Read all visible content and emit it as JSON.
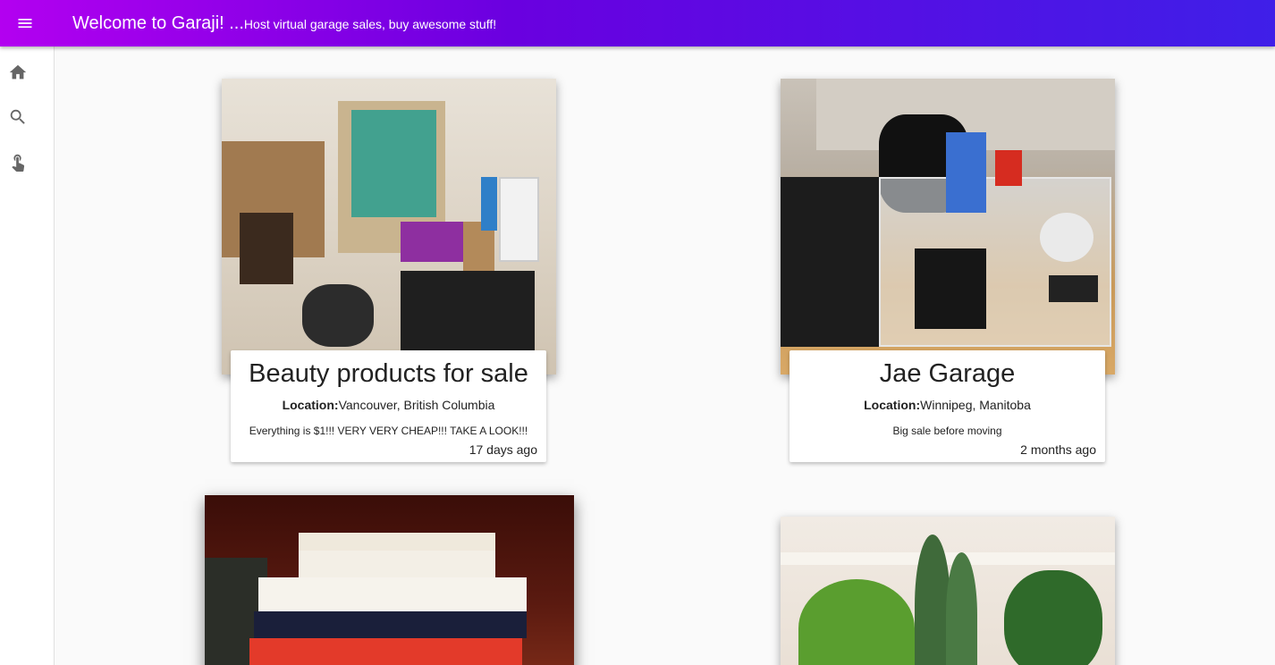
{
  "appbar": {
    "title": "Welcome to Garaji! ...",
    "subtitle": "Host virtual garage sales, buy awesome stuff!",
    "menu_icon": "menu-icon"
  },
  "sidebar": {
    "items": [
      {
        "name": "home",
        "icon": "home-icon"
      },
      {
        "name": "search",
        "icon": "search-icon"
      },
      {
        "name": "touch",
        "icon": "touch-icon"
      }
    ]
  },
  "sales": [
    {
      "title": "Beauty products for sale",
      "location_label": "Location:",
      "location": "Vancouver, British Columbia",
      "description": "Everything is $1!!! VERY VERY CHEAP!!! TAKE A LOOK!!!",
      "posted": "17 days ago"
    },
    {
      "title": "Jae Garage",
      "location_label": "Location:",
      "location": "Winnipeg, Manitoba",
      "description": "Big sale before moving",
      "posted": "2 months ago"
    }
  ],
  "colors": {
    "appbar_start": "#b300f0",
    "appbar_end": "#3f1fe8"
  }
}
